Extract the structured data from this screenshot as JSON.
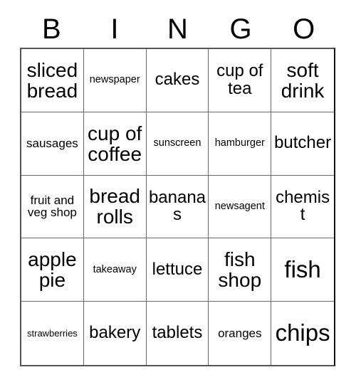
{
  "card": {
    "header_letters": [
      "B",
      "I",
      "N",
      "G",
      "O"
    ],
    "rows": [
      [
        {
          "text": "sliced bread",
          "size": "lg"
        },
        {
          "text": "newspaper",
          "size": "xs"
        },
        {
          "text": "cakes",
          "size": "md"
        },
        {
          "text": "cup of tea",
          "size": "md"
        },
        {
          "text": "soft drink",
          "size": "lg"
        }
      ],
      [
        {
          "text": "sausages",
          "size": "sm"
        },
        {
          "text": "cup of coffee",
          "size": "lg"
        },
        {
          "text": "sunscreen",
          "size": "xs"
        },
        {
          "text": "hamburger",
          "size": "xs"
        },
        {
          "text": "butcher",
          "size": "md"
        }
      ],
      [
        {
          "text": "fruit and veg shop",
          "size": "sm"
        },
        {
          "text": "bread rolls",
          "size": "lg"
        },
        {
          "text": "bananas",
          "size": "md"
        },
        {
          "text": "newsagent",
          "size": "xs"
        },
        {
          "text": "chemist",
          "size": "md"
        }
      ],
      [
        {
          "text": "apple pie",
          "size": "lg"
        },
        {
          "text": "takeaway",
          "size": "xs"
        },
        {
          "text": "lettuce",
          "size": "md"
        },
        {
          "text": "fish shop",
          "size": "lg"
        },
        {
          "text": "fish",
          "size": "xl"
        }
      ],
      [
        {
          "text": "strawberries",
          "size": "xxs"
        },
        {
          "text": "bakery",
          "size": "md"
        },
        {
          "text": "tablets",
          "size": "md"
        },
        {
          "text": "oranges",
          "size": "sm"
        },
        {
          "text": "chips",
          "size": "xl"
        }
      ]
    ]
  }
}
